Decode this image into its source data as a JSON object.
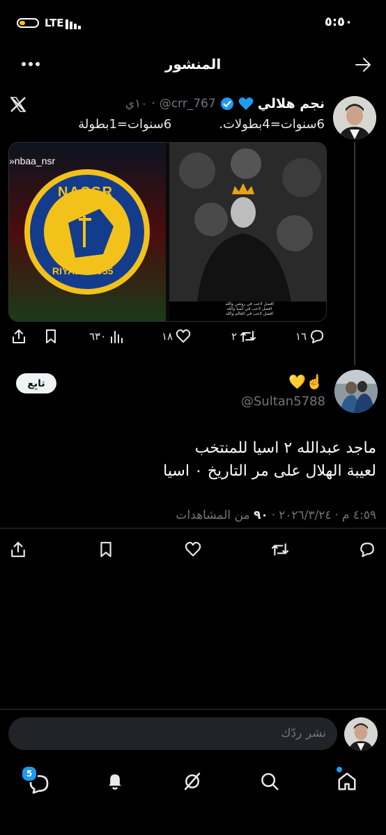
{
  "status": {
    "time": "٥:٥٠",
    "network": "LTE"
  },
  "header": {
    "title": "المنشور"
  },
  "quoted": {
    "name": "نجم هلالي",
    "handle": "@crr_767",
    "time": "١٠ي",
    "text_line1": "6سنوات=4بطولات.",
    "text_line2": "6سنوات=1بطولة",
    "image_left_credit": "nbaa_nsr",
    "logo_top": "NASSR",
    "logo_bottom": "RIYADH 1955",
    "right_caption": [
      "افضل لاعب في روشن والله",
      "افضل لاعب في اسيا والله",
      "افضل لاعب في العالم والله"
    ],
    "replies": "١٦",
    "retweets": "٢",
    "likes": "١٨",
    "views": "٦٣٠"
  },
  "reply": {
    "emoji": "☝️💛",
    "handle": "@Sultan5788",
    "follow_label": "تابِع",
    "text_line1": "ماجد عبدالله ٢ اسيا للمنتخب",
    "text_line2": "لعيبة الهلال على مر التاريخ ٠ اسيا",
    "meta": "٤:٥٩ م · ٢٠٢٦/٣/٢٤ · ٩٠ من المشاهدات",
    "meta_time": "٤:٥٩ م",
    "meta_date": "٢٠٢٦/٣/٢٤",
    "meta_views": "٩٠",
    "meta_views_label": "من المشاهدات"
  },
  "composer": {
    "placeholder": "نشر ردّك"
  },
  "nav": {
    "messages_badge": "5"
  },
  "colors": {
    "verified": "#1d9bf0",
    "accent": "#1d9bf0",
    "heart_blue": "#1d9bf0",
    "separator": "#2f3336"
  }
}
